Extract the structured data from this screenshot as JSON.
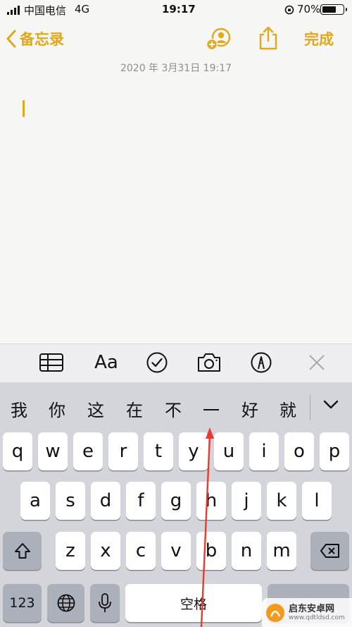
{
  "status_bar": {
    "carrier": "中国电信",
    "network": "4G",
    "time": "19:17",
    "battery": "70%",
    "battery_level": 0.7
  },
  "nav": {
    "back_label": "备忘录",
    "done_label": "完成"
  },
  "note": {
    "date": "2020 年 3月31日 19:17"
  },
  "toolbar": {
    "items": [
      "table-icon",
      "format-icon",
      "checklist-icon",
      "camera-icon",
      "markup-icon",
      "close-icon"
    ],
    "format_label": "Aa"
  },
  "candidates": [
    "我",
    "你",
    "这",
    "在",
    "不",
    "一",
    "好",
    "就"
  ],
  "keyboard": {
    "row1": [
      "q",
      "w",
      "e",
      "r",
      "t",
      "y",
      "u",
      "i",
      "o",
      "p"
    ],
    "row2": [
      "a",
      "s",
      "d",
      "f",
      "g",
      "h",
      "j",
      "k",
      "l"
    ],
    "row3": [
      "z",
      "x",
      "c",
      "v",
      "b",
      "n",
      "m"
    ],
    "numbers_label": "123",
    "space_label": "空格"
  },
  "watermark": {
    "title": "启东安卓网",
    "url": "www.qdtldsd.com"
  },
  "colors": {
    "accent": "#e1a81b",
    "arrow": "#e83a2e"
  }
}
